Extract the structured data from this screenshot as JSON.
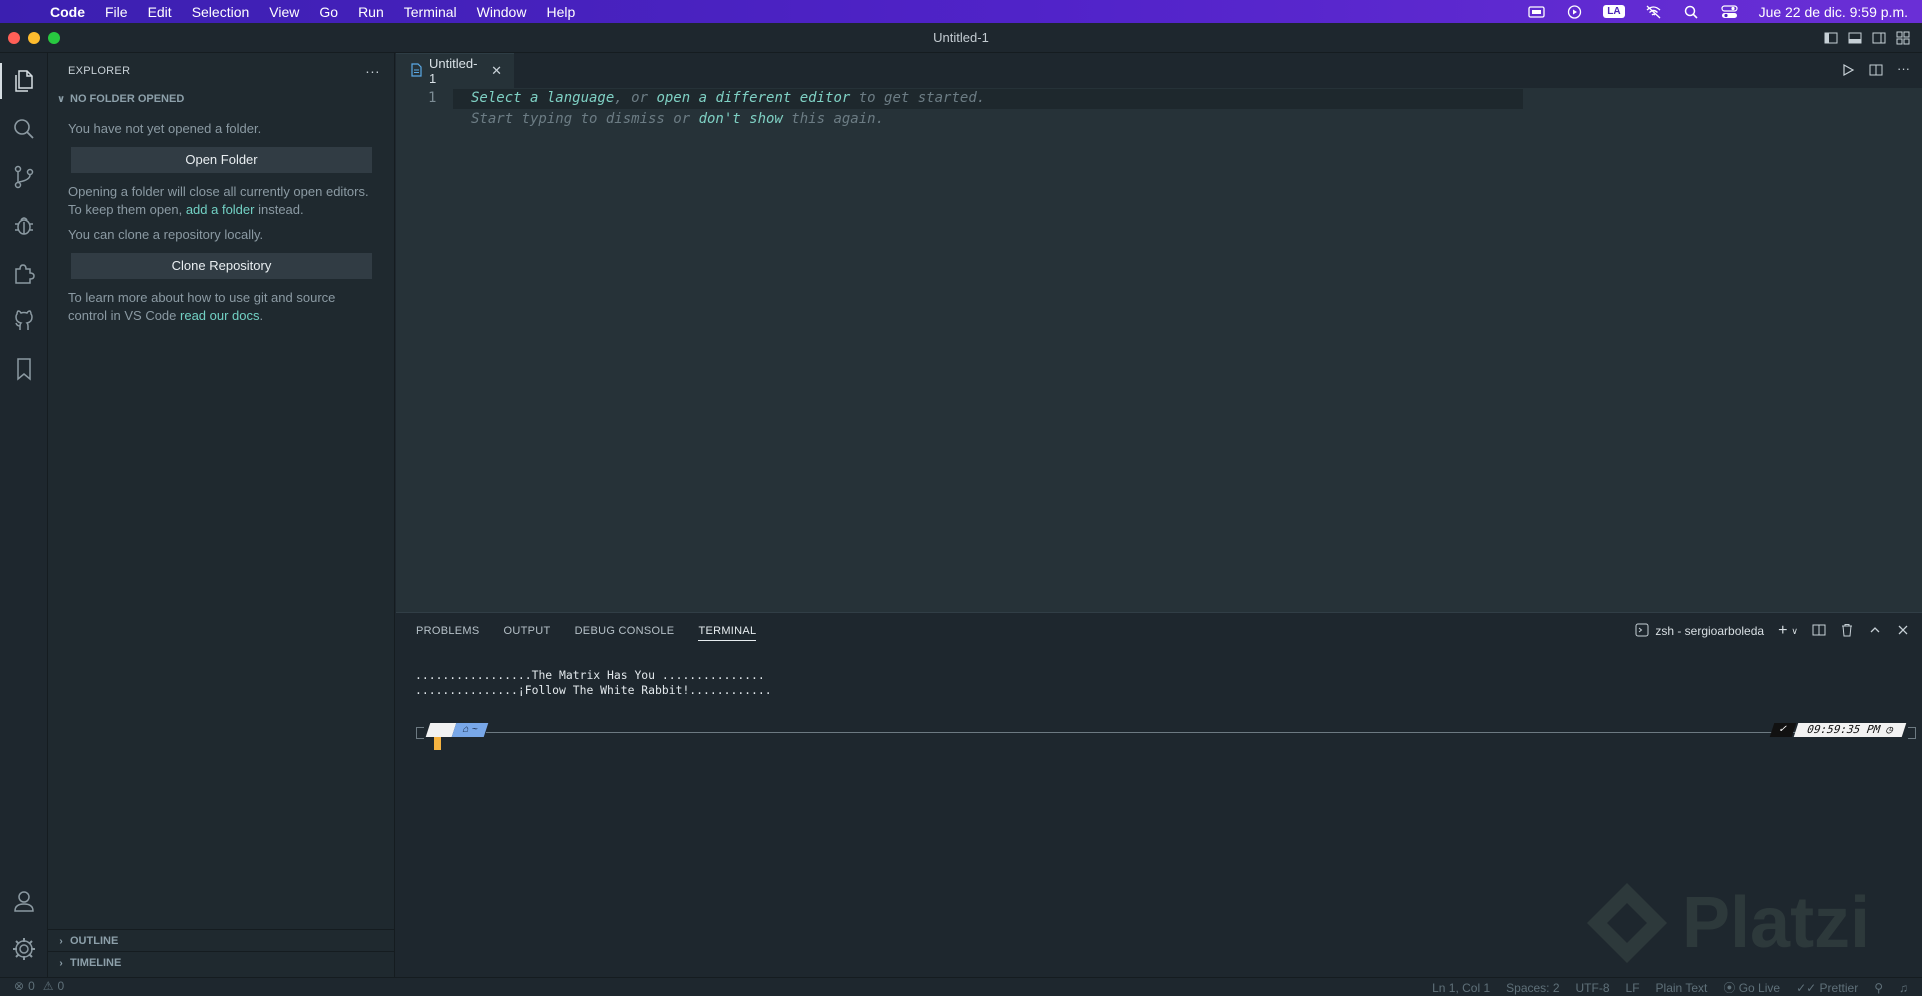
{
  "menubar": {
    "app_name": "Code",
    "items": [
      "File",
      "Edit",
      "Selection",
      "View",
      "Go",
      "Run",
      "Terminal",
      "Window",
      "Help"
    ],
    "input_source": "LA",
    "clock": "Jue 22 de dic.  9:59 p.m."
  },
  "window": {
    "title": "Untitled-1"
  },
  "sidebar": {
    "header": "EXPLORER",
    "section_title": "NO FOLDER OPENED",
    "no_folder_text": "You have not yet opened a folder.",
    "open_folder_label": "Open Folder",
    "warning_text_before": "Opening a folder will close all currently open editors. To keep them open, ",
    "warning_link": "add a folder",
    "warning_text_after": " instead.",
    "clone_text": "You can clone a repository locally.",
    "clone_label": "Clone Repository",
    "learn_text_before": "To learn more about how to use git and source control in VS Code ",
    "learn_link": "read our docs",
    "learn_text_after": ".",
    "outline_label": "OUTLINE",
    "timeline_label": "TIMELINE"
  },
  "editor": {
    "tab_label": "Untitled-1",
    "line_number": "1",
    "hint_select_language": "Select a language",
    "hint_or": ", or ",
    "hint_open_editor": "open a different editor",
    "hint_get_started": " to get started.",
    "hint_start_typing": "Start typing to dismiss or ",
    "hint_dont_show": "don't show",
    "hint_this_again": " this again."
  },
  "panel": {
    "tabs": [
      "PROBLEMS",
      "OUTPUT",
      "DEBUG CONSOLE",
      "TERMINAL"
    ],
    "active_tab": "TERMINAL",
    "terminal_name": "zsh - sergioarboleda",
    "terminal_lines": [
      ".................The Matrix Has You ...............",
      "...............¡Follow The White Rabbit!............"
    ],
    "prompt_dir": "~",
    "prompt_status": "✓",
    "prompt_time": "09:59:35 PM"
  },
  "statusbar": {
    "errors": "0",
    "warnings": "0",
    "position": "Ln 1, Col 1",
    "spaces": "Spaces: 2",
    "encoding": "UTF-8",
    "eol": "LF",
    "language": "Plain Text",
    "go_live": "Go Live",
    "prettier": "Prettier"
  },
  "watermark": {
    "text": "Platzi"
  },
  "colors": {
    "accent": "#72d1c4",
    "editor_bg": "#263238",
    "sidebar_bg": "#1f292f",
    "menubar_bg": "#4b22c2",
    "cursor": "#f5b341"
  }
}
